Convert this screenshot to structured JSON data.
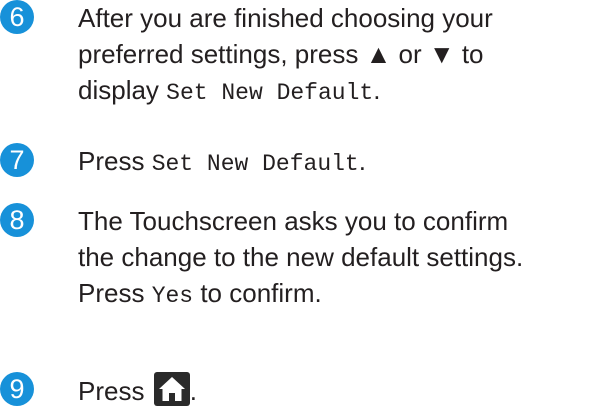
{
  "steps": [
    {
      "number": "6",
      "line1": "After you are finished choosing your",
      "line2": "preferred settings, press ▲ or ▼ to",
      "line3_prefix": "display ",
      "line3_code": "Set New Default",
      "line3_suffix": "."
    },
    {
      "number": "7",
      "prefix": "Press ",
      "code": "Set New Default",
      "suffix": "."
    },
    {
      "number": "8",
      "line1": "The Touchscreen asks you to confirm",
      "line2": "the change to the new default settings.",
      "line3_prefix": "Press ",
      "line3_code": "Yes",
      "line3_suffix": " to confirm."
    },
    {
      "number": "9",
      "prefix": "Press ",
      "icon": "home-icon",
      "suffix": "."
    }
  ],
  "colors": {
    "badge": "#1791d9",
    "text": "#231f20"
  }
}
